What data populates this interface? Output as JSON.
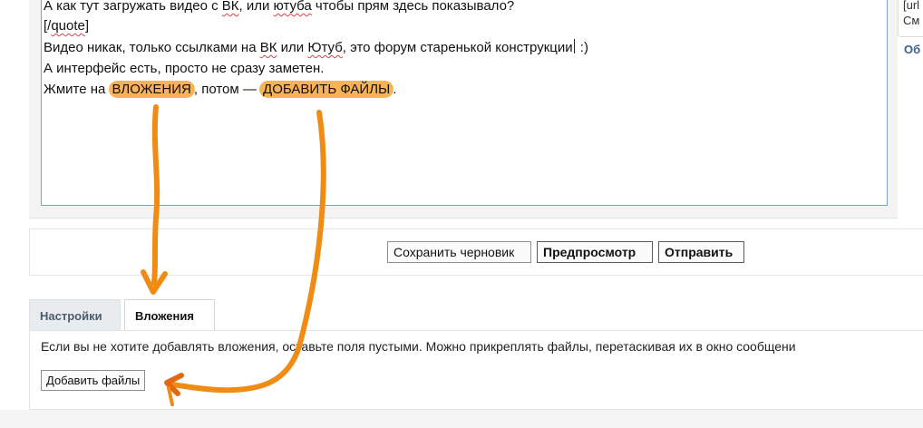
{
  "editor": {
    "line1": {
      "before": "А как тут загружать видео с ",
      "vk": "ВК",
      "mid": ", или ",
      "yt": "ютуба",
      "after": " чтобы прям здесь показывало?"
    },
    "line2": {
      "open": "[/",
      "word": "quote",
      "close": "]"
    },
    "line3": {
      "before": "Видео никак, только ссылками на ",
      "vk": "ВК",
      "mid1": " или ",
      "yt": "Ютуб",
      "mid2": ", это форум ",
      "old": "старенькой",
      "mid3": " ",
      "constr": "конструкции",
      "smile": " :)"
    },
    "line4": "А интерфейс есть, просто не сразу заметен.",
    "line5": {
      "before": "Жмите на ",
      "hl1": "ВЛОЖЕНИЯ",
      "mid": ", потом — ",
      "hl2": "ДОБАВИТЬ ФАЙЛЫ",
      "after": "."
    }
  },
  "sidebar": {
    "line1": "[url",
    "line2": "См",
    "link": "Об"
  },
  "buttons": {
    "save_draft": "Сохранить черновик",
    "preview": "Предпросмотр",
    "submit": "Отправить"
  },
  "tabs": [
    {
      "label": "Настройки",
      "active": false
    },
    {
      "label": "Вложения",
      "active": true
    }
  ],
  "attachments": {
    "description": "Если вы не хотите добавлять вложения, оставьте поля пустыми. Можно прикреплять файлы, перетаскивая их в окно сообщени",
    "add_button": "Добавить файлы"
  },
  "colors": {
    "highlight": "#f7b356",
    "arrow": "#f08c14",
    "editor_border": "#7aa5cf",
    "link": "#3a5f8c"
  }
}
